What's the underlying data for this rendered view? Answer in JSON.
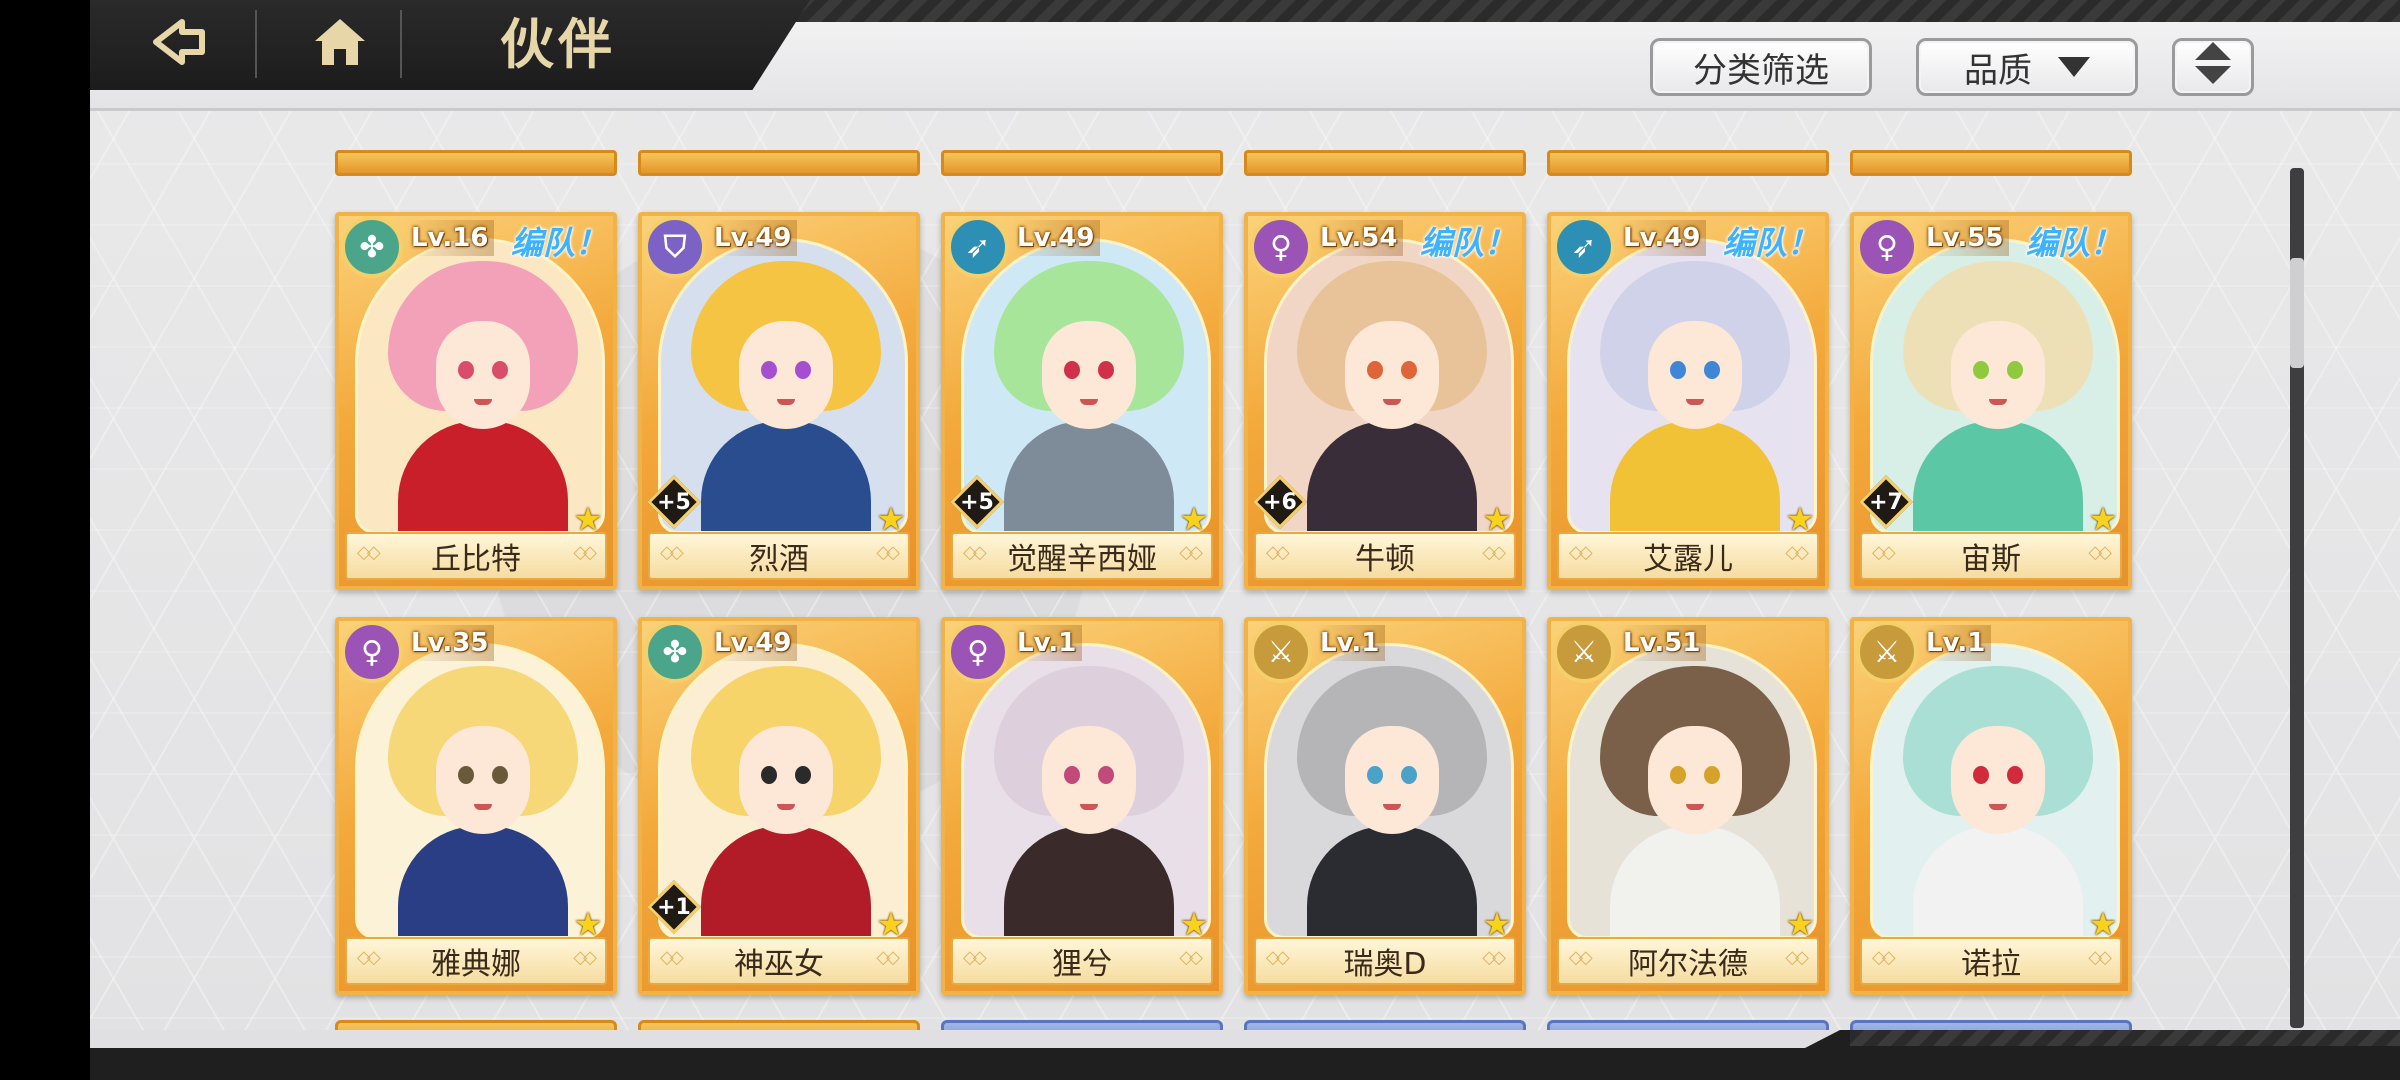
{
  "header": {
    "title": "伙伴"
  },
  "toolbar": {
    "filter_label": "分类筛选",
    "quality_label": "品质"
  },
  "colors": {
    "accent_gold": "#f3a93b",
    "team_tag": "#3db2ff"
  },
  "partners": [
    {
      "name": "丘比特",
      "level": "Lv.16",
      "team": "编队！",
      "plus": "",
      "class_icon": "clover-icon",
      "class_color": "#4aa58a",
      "hair": "#f2a1b8",
      "eye": "#d94d6b",
      "body": "#c81f2a",
      "bg": "#fbe7c2"
    },
    {
      "name": "烈酒",
      "level": "Lv.49",
      "team": "",
      "plus": "+5",
      "class_icon": "shield-icon",
      "class_color": "#7b62c4",
      "hair": "#f5c443",
      "eye": "#a54fd0",
      "body": "#2a4d8f",
      "bg": "#d6dfee"
    },
    {
      "name": "觉醒辛西娅",
      "level": "Lv.49",
      "team": "",
      "plus": "+5",
      "class_icon": "bow-icon",
      "class_color": "#2d8fb3",
      "hair": "#a6e59a",
      "eye": "#d0304a",
      "body": "#7e8c9a",
      "bg": "#cfe8f5"
    },
    {
      "name": "牛顿",
      "level": "Lv.54",
      "team": "编队！",
      "plus": "+6",
      "class_icon": "staff-icon",
      "class_color": "#9b53b5",
      "hair": "#e8c39a",
      "eye": "#e0643a",
      "body": "#3a2d3a",
      "bg": "#f1d6c5"
    },
    {
      "name": "艾露儿",
      "level": "Lv.49",
      "team": "编队！",
      "plus": "",
      "class_icon": "bow-icon",
      "class_color": "#2d8fb3",
      "hair": "#cfd2e8",
      "eye": "#3e86d6",
      "body": "#f2c236",
      "bg": "#e7e2f0"
    },
    {
      "name": "宙斯",
      "level": "Lv.55",
      "team": "编队！",
      "plus": "+7",
      "class_icon": "staff-icon",
      "class_color": "#9b53b5",
      "hair": "#eee0b6",
      "eye": "#8fc93e",
      "body": "#5cc7a5",
      "bg": "#d7efe6"
    },
    {
      "name": "雅典娜",
      "level": "Lv.35",
      "team": "",
      "plus": "",
      "class_icon": "staff-icon",
      "class_color": "#9b53b5",
      "hair": "#f6d879",
      "eye": "#6b5a3a",
      "body": "#2a3e86",
      "bg": "#fbf2d8"
    },
    {
      "name": "神巫女",
      "level": "Lv.49",
      "team": "",
      "plus": "+1",
      "class_icon": "clover-icon",
      "class_color": "#4aa58a",
      "hair": "#f6d46a",
      "eye": "#2a2a2a",
      "body": "#b21c28",
      "bg": "#fbeed2"
    },
    {
      "name": "狸兮",
      "level": "Lv.1",
      "team": "",
      "plus": "",
      "class_icon": "staff-icon",
      "class_color": "#9b53b5",
      "hair": "#ddd0dc",
      "eye": "#c24a7a",
      "body": "#3a2a2a",
      "bg": "#e8dfe9"
    },
    {
      "name": "瑞奥D",
      "level": "Lv.1",
      "team": "",
      "plus": "",
      "class_icon": "sword-icon",
      "class_color": "#c79a3b",
      "hair": "#b5b5b8",
      "eye": "#4aa2c8",
      "body": "#2b2c31",
      "bg": "#d9d9dc"
    },
    {
      "name": "阿尔法德",
      "level": "Lv.51",
      "team": "",
      "plus": "",
      "class_icon": "sword-icon",
      "class_color": "#c79a3b",
      "hair": "#7a6048",
      "eye": "#d6a22a",
      "body": "#f1f1ee",
      "bg": "#e6e2d8"
    },
    {
      "name": "诺拉",
      "level": "Lv.1",
      "team": "",
      "plus": "",
      "class_icon": "sword-icon",
      "class_color": "#c79a3b",
      "hair": "#a9dfd4",
      "eye": "#d12a3a",
      "body": "#f2f2f2",
      "bg": "#e2f1ef"
    }
  ]
}
